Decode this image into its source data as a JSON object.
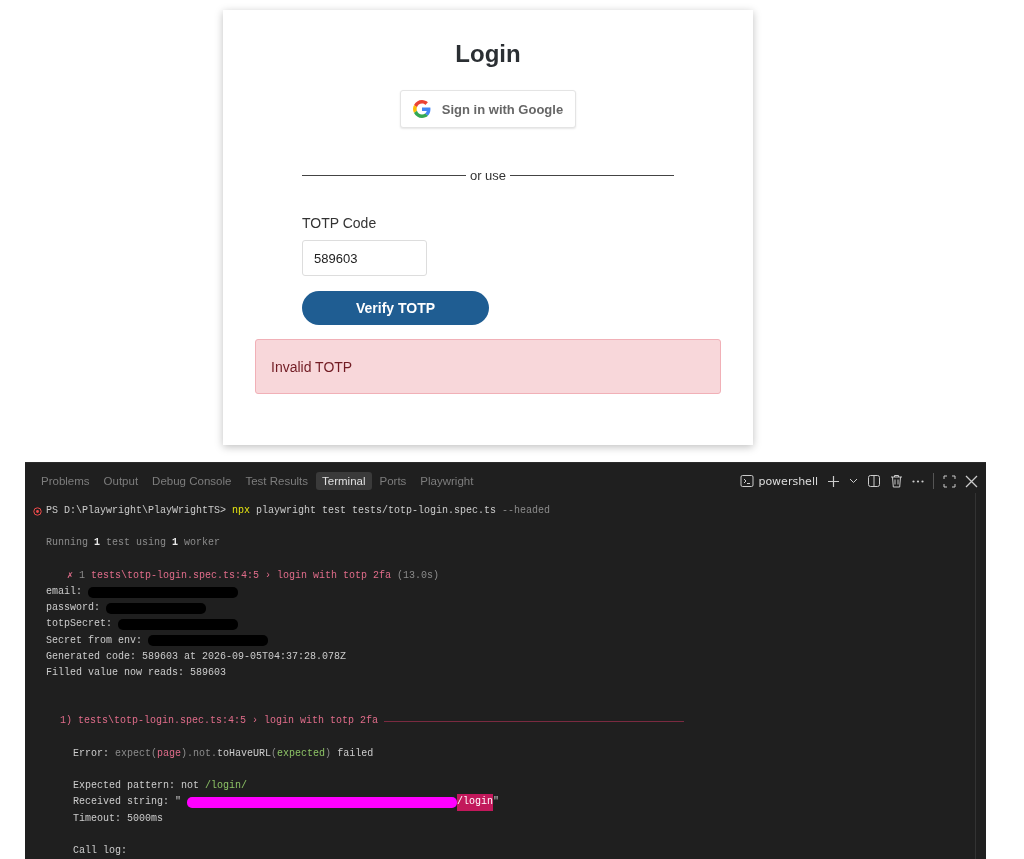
{
  "login_card": {
    "title": "Login",
    "google_button": "Sign in with Google",
    "divider_text": "or use",
    "field_label": "TOTP Code",
    "field_value": "589603",
    "submit_button": "Verify TOTP",
    "error_message": "Invalid TOTP"
  },
  "panel": {
    "tabs": [
      {
        "label": "Problems",
        "selected": false
      },
      {
        "label": "Output",
        "selected": false
      },
      {
        "label": "Debug Console",
        "selected": false
      },
      {
        "label": "Test Results",
        "selected": false
      },
      {
        "label": "Terminal",
        "selected": true
      },
      {
        "label": "Ports",
        "selected": false
      },
      {
        "label": "Playwright",
        "selected": false
      }
    ],
    "shell_label": "powershell",
    "lines": [
      {
        "kind": "prompt",
        "exit_error": true,
        "segments": [
          {
            "kind": "plain",
            "text": "PS D:\\Playwright\\PlayWrightTS>"
          },
          {
            "kind": "command",
            "text": "npx"
          },
          {
            "kind": "plain",
            "text": "playwright test tests/totp-login.spec.ts"
          },
          {
            "kind": "dim",
            "text": "--headed"
          }
        ]
      },
      {
        "kind": "blank"
      },
      {
        "kind": "indent1",
        "segments": [
          {
            "kind": "dim",
            "text": "Running"
          },
          {
            "kind": "emphasis",
            "text": "1"
          },
          {
            "kind": "dim",
            "text": "test using"
          },
          {
            "kind": "emphasis",
            "text": "1"
          },
          {
            "kind": "dim",
            "text": "worker"
          }
        ]
      },
      {
        "kind": "blank"
      },
      {
        "kind": "indent2",
        "segments": [
          {
            "kind": "failure",
            "text": "✗"
          },
          {
            "kind": "dim",
            "text": "1"
          },
          {
            "kind": "failure",
            "text": "tests\\totp-login.spec.ts:4:5 › login with totp 2fa"
          },
          {
            "kind": "dim",
            "text": "(13.0s)"
          }
        ]
      },
      {
        "kind": "indent1",
        "segments": [
          {
            "kind": "plain",
            "text": "email:"
          },
          {
            "kind": "redacted",
            "color": "#000000"
          }
        ]
      },
      {
        "kind": "indent1",
        "segments": [
          {
            "kind": "plain",
            "text": "password:"
          },
          {
            "kind": "redacted",
            "color": "#000000"
          }
        ]
      },
      {
        "kind": "indent1",
        "segments": [
          {
            "kind": "plain",
            "text": "totpSecret:"
          },
          {
            "kind": "redacted",
            "color": "#000000"
          }
        ]
      },
      {
        "kind": "indent1",
        "segments": [
          {
            "kind": "plain",
            "text": "Secret from env:"
          },
          {
            "kind": "redacted",
            "color": "#000000"
          }
        ]
      },
      {
        "kind": "indent1",
        "segments": [
          {
            "kind": "plain",
            "text": "Generated code: 589603 at 2026-09-05T04:37:28.078Z"
          }
        ]
      },
      {
        "kind": "indent1",
        "segments": [
          {
            "kind": "plain",
            "text": "Filled value now reads: 589603"
          }
        ]
      },
      {
        "kind": "blank"
      },
      {
        "kind": "blank"
      },
      {
        "kind": "heading",
        "segments": [
          {
            "kind": "failure",
            "text": "1) tests\\totp-login.spec.ts:4:5 › login with totp 2fa"
          }
        ]
      },
      {
        "kind": "blank"
      },
      {
        "kind": "indent3",
        "segments": [
          {
            "kind": "plain",
            "text": "Error:"
          },
          {
            "kind": "dim",
            "text": "expect("
          },
          {
            "kind": "failure",
            "text": "page"
          },
          {
            "kind": "dim",
            "text": ").not."
          },
          {
            "kind": "plain",
            "text": "toHaveURL"
          },
          {
            "kind": "dim",
            "text": "("
          },
          {
            "kind": "match",
            "text": "expected"
          },
          {
            "kind": "dim",
            "text": ")"
          },
          {
            "kind": "plain",
            "text": "failed"
          }
        ]
      },
      {
        "kind": "blank"
      },
      {
        "kind": "indent3",
        "segments": [
          {
            "kind": "plain",
            "text": "Expected pattern: not"
          },
          {
            "kind": "match",
            "text": "/login/"
          }
        ]
      },
      {
        "kind": "indent3",
        "segments": [
          {
            "kind": "plain",
            "text": "Received string: \""
          },
          {
            "kind": "redacted",
            "color": "#ff00ff"
          },
          {
            "kind": "highlight",
            "text": "/login"
          },
          {
            "kind": "plain",
            "text": "\""
          }
        ]
      },
      {
        "kind": "indent3",
        "segments": [
          {
            "kind": "plain",
            "text": "Timeout: 5000ms"
          }
        ]
      },
      {
        "kind": "blank"
      },
      {
        "kind": "indent3",
        "segments": [
          {
            "kind": "plain",
            "text": "Call log:"
          }
        ]
      }
    ]
  }
}
